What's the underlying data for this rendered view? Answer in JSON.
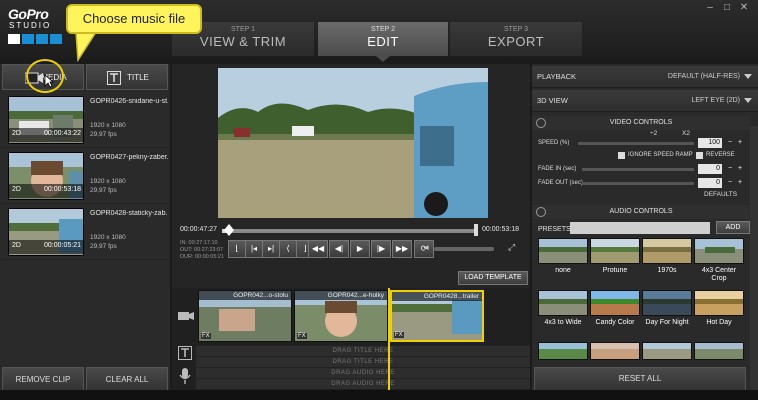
{
  "brand": {
    "line1": "GoPro",
    "line2": "STUDIO",
    "squares": [
      "#ffffff",
      "#1a8fd6",
      "#1a8fd6",
      "#1a8fd6"
    ]
  },
  "steps": [
    {
      "num": "STEP 1",
      "label": "VIEW & TRIM"
    },
    {
      "num": "STEP 2",
      "label": "EDIT"
    },
    {
      "num": "STEP 3",
      "label": "EXPORT"
    }
  ],
  "window_controls": [
    "–",
    "□",
    "✕"
  ],
  "callout": {
    "text": "Choose music file"
  },
  "left": {
    "tabs": {
      "media": "MEDIA",
      "title": "TITLE"
    },
    "clips": [
      {
        "name": "GOPR0426-snidane-u-st...",
        "res": "1920 x 1080",
        "fps": "29,97 fps",
        "dim": "2D",
        "dur": "00:00:43:22"
      },
      {
        "name": "GOPR0427-pekny-zaber...",
        "res": "1920 x 1080",
        "fps": "29,97 fps",
        "dim": "2D",
        "dur": "00:00:53:18"
      },
      {
        "name": "GOPR0428-staticky-zab...",
        "res": "1920 x 1080",
        "fps": "29,97 fps",
        "dim": "2D",
        "dur": "00:00:05:21"
      }
    ],
    "remove_clip": "REMOVE CLIP",
    "clear_all": "CLEAR ALL"
  },
  "player": {
    "current": "00:00:47:27",
    "end": "00:00:53:18",
    "in": "IN: 00:27:17:10",
    "out": "OUT: 00:27:23:07",
    "dur": "DUR: 00:00:05:21",
    "progress": 0.02
  },
  "load_template": "LOAD TEMPLATE",
  "timeline": {
    "clips": [
      {
        "label": "GOPR042...o-stolu",
        "fx": "FX"
      },
      {
        "label": "GOPR042...e-holky",
        "fx": "FX"
      },
      {
        "label": "GOPR0428...trailer",
        "fx": "FX"
      }
    ],
    "drag_title_1": "DRAG TITLE HERE",
    "drag_title_2": "DRAG TITLE HERE",
    "drag_audio_1": "DRAG AUDIO HERE",
    "drag_audio_2": "DRAG AUDIO HERE"
  },
  "right": {
    "playback": {
      "label": "PLAYBACK",
      "value": "DEFAULT (HALF-RES)"
    },
    "view3d": {
      "label": "3D VIEW",
      "value": "LEFT EYE (2D)"
    },
    "video_controls": "VIDEO CONTROLS",
    "x2a": "÷2",
    "x2b": "X2",
    "speed": {
      "label": "SPEED (%)",
      "value": "100"
    },
    "ignore_ramp": "IGNORE SPEED RAMP",
    "reverse": "REVERSE",
    "fade_in": {
      "label": "FADE IN (sec)",
      "value": "0"
    },
    "fade_out": {
      "label": "FADE OUT (sec)",
      "value": "0"
    },
    "defaults": "DEFAULTS",
    "audio_controls": "AUDIO CONTROLS",
    "presets_label": "PRESETS",
    "add": "ADD",
    "presets": [
      {
        "label": "none"
      },
      {
        "label": "Protune"
      },
      {
        "label": "1970s"
      },
      {
        "label": "4x3 Center Crop"
      },
      {
        "label": "4x3 to Wide"
      },
      {
        "label": "Candy Color"
      },
      {
        "label": "Day For Night"
      },
      {
        "label": "Hot Day"
      }
    ],
    "reset_all": "RESET ALL"
  }
}
